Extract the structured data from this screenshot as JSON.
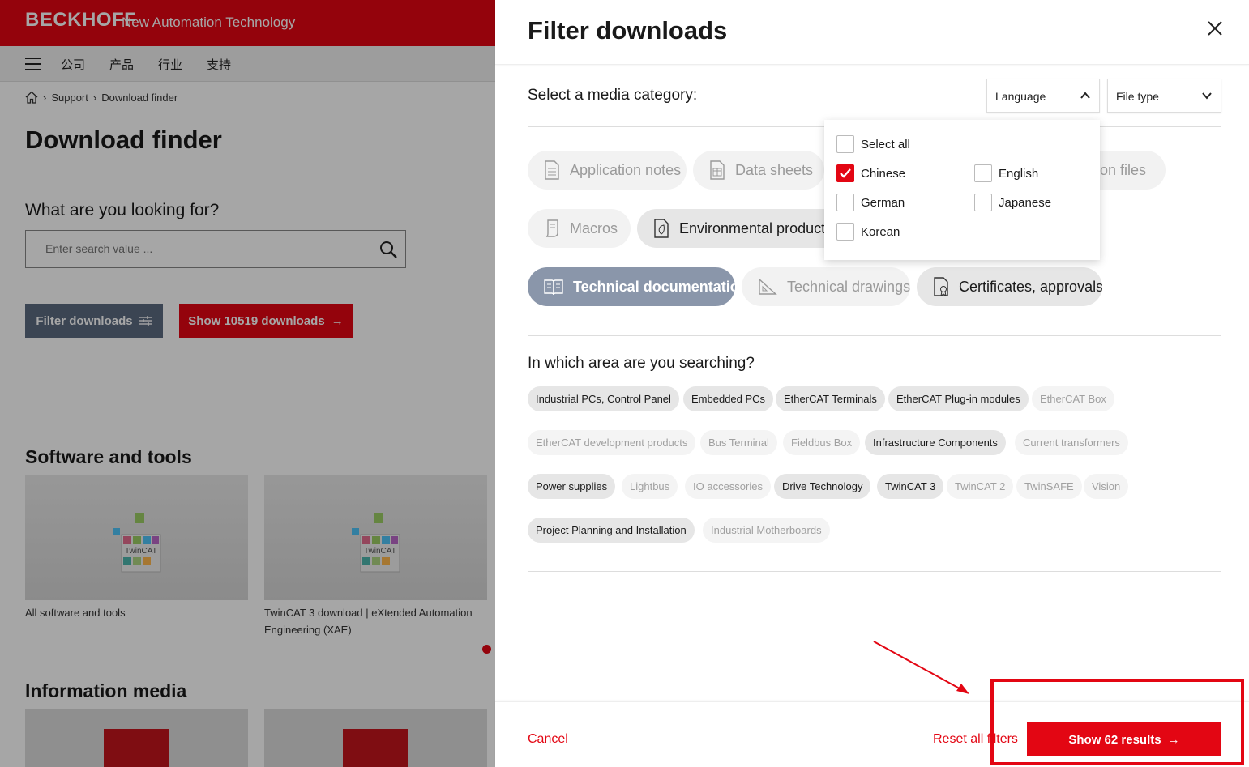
{
  "header": {
    "brand": "BECKHOFF",
    "tagline": "New Automation Technology"
  },
  "nav": {
    "items": [
      "公司",
      "产品",
      "行业",
      "支持"
    ]
  },
  "breadcrumb": {
    "items": [
      "Support",
      "Download finder"
    ]
  },
  "page": {
    "title": "Download finder",
    "search_heading": "What are you looking for?",
    "search_placeholder": "Enter search value ...",
    "filter_button": "Filter downloads",
    "show_button": "Show 10519 downloads"
  },
  "software": {
    "title": "Software and tools",
    "tiles": [
      {
        "caption": "All software and tools"
      },
      {
        "caption": "TwinCAT 3 download | eXtended Automation Engineering (XAE)"
      }
    ],
    "tile_logo_text": "TwinCAT"
  },
  "info": {
    "title": "Information media"
  },
  "drawer": {
    "title": "Filter downloads",
    "media_label": "Select a media category:",
    "language_select": "Language",
    "filetype_select": "File type",
    "categories": [
      {
        "label": "Application notes",
        "state": "disabled",
        "icon": "document-icon"
      },
      {
        "label": "Data sheets",
        "state": "disabled",
        "icon": "datasheet-icon"
      },
      {
        "label": "tion files",
        "state": "disabled",
        "icon": ""
      },
      {
        "label": "Macros",
        "state": "disabled",
        "icon": "scroll-icon"
      },
      {
        "label": "Environmental product co",
        "state": "enabled",
        "icon": "leaf-document-icon"
      },
      {
        "label": "Technical documentations",
        "state": "active",
        "icon": "book-icon"
      },
      {
        "label": "Technical drawings",
        "state": "disabled",
        "icon": "set-square-icon"
      },
      {
        "label": "Certificates, approvals",
        "state": "enabled",
        "icon": "certificate-icon"
      }
    ],
    "language_dropdown": {
      "options": [
        {
          "label": "Select all",
          "checked": false
        },
        {
          "label": "Chinese",
          "checked": true
        },
        {
          "label": "English",
          "checked": false
        },
        {
          "label": "German",
          "checked": false
        },
        {
          "label": "Japanese",
          "checked": false
        },
        {
          "label": "Korean",
          "checked": false
        }
      ]
    },
    "area_label": "In which area are you searching?",
    "areas": [
      {
        "label": "Industrial PCs, Control Panel",
        "enabled": true
      },
      {
        "label": "Embedded PCs",
        "enabled": true
      },
      {
        "label": "EtherCAT Terminals",
        "enabled": true
      },
      {
        "label": "EtherCAT Plug-in modules",
        "enabled": true
      },
      {
        "label": "EtherCAT Box",
        "enabled": false
      },
      {
        "label": "EtherCAT development products",
        "enabled": false
      },
      {
        "label": "Bus Terminal",
        "enabled": false
      },
      {
        "label": "Fieldbus Box",
        "enabled": false
      },
      {
        "label": "Infrastructure Components",
        "enabled": true
      },
      {
        "label": "Current transformers",
        "enabled": false
      },
      {
        "label": "Power supplies",
        "enabled": true
      },
      {
        "label": "Lightbus",
        "enabled": false
      },
      {
        "label": "IO accessories",
        "enabled": false
      },
      {
        "label": "Drive Technology",
        "enabled": true
      },
      {
        "label": "TwinCAT 3",
        "enabled": true
      },
      {
        "label": "TwinCAT 2",
        "enabled": false
      },
      {
        "label": "TwinSAFE",
        "enabled": false
      },
      {
        "label": "Vision",
        "enabled": false
      },
      {
        "label": "Project Planning and Installation",
        "enabled": true
      },
      {
        "label": "Industrial Motherboards",
        "enabled": false
      }
    ],
    "footer": {
      "cancel": "Cancel",
      "reset": "Reset all filters",
      "show_results": "Show 62 results"
    }
  },
  "colors": {
    "brand_red": "#e30613",
    "active_chip": "#8a96aa",
    "filter_button": "#5b6a80"
  }
}
